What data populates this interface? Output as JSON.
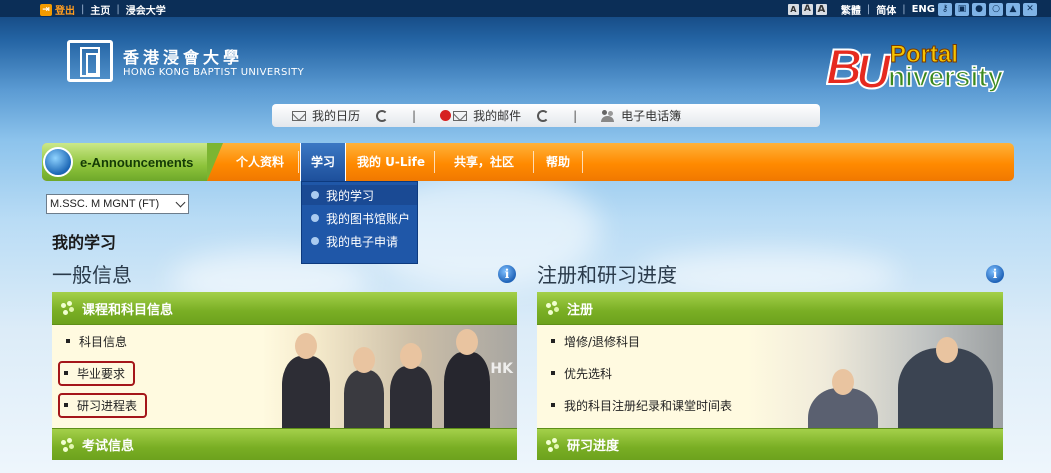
{
  "topbar": {
    "logout": "登出",
    "links": [
      "主页",
      "浸会大学"
    ],
    "font_size_labels": [
      "A",
      "A",
      "A"
    ],
    "lang": [
      "繁體",
      "简体",
      "ENG"
    ],
    "quick_icons": [
      "key-icon",
      "lock-icon",
      "circle-icon",
      "search-icon",
      "image-icon",
      "tools-icon"
    ]
  },
  "header": {
    "university_cn": "香港浸會大學",
    "university_en": "HONG KONG BAPTIST UNIVERSITY",
    "portal_logo_text": "BU Portal University"
  },
  "quickbar": {
    "calendar": "我的日历",
    "mail": "我的邮件",
    "directory": "电子电话簿"
  },
  "nav": {
    "announcements": "e-Announcements",
    "tabs": [
      "个人资料",
      "学习",
      "我的 U-Life",
      "共享，社区",
      "帮助"
    ],
    "active_tab": "学习"
  },
  "dropdown": {
    "items": [
      "我的学习",
      "我的图书馆账户",
      "我的电子申请"
    ]
  },
  "programme_select": {
    "value": "M.SSC. M MGNT (FT)"
  },
  "page": {
    "title": "我的学习"
  },
  "left": {
    "section_title": "一般信息",
    "panel_header": "课程和科目信息",
    "items": [
      "科目信息",
      "毕业要求",
      "研习进程表"
    ],
    "footer_header": "考试信息",
    "photo_watermark": "HK"
  },
  "right": {
    "section_title": "注册和研习进度",
    "panel_header": "注册",
    "items": [
      "增修/退修科目",
      "优先选科",
      "我的科目注册纪录和课堂时间表"
    ],
    "footer_header": "研习进度"
  },
  "colors": {
    "nav_orange": "#ff8a00",
    "nav_green": "#8dc33b",
    "active_tab_blue": "#1d4f9b",
    "panel_green": "#79ae24",
    "highlight_red": "#a4161a"
  }
}
